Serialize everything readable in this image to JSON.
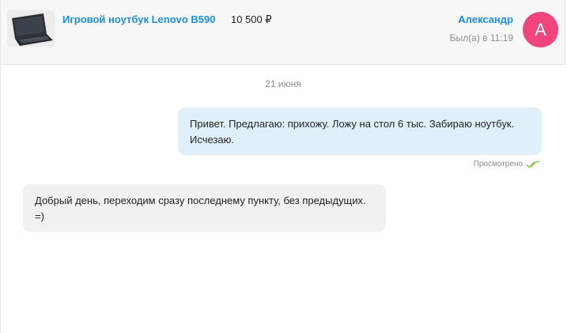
{
  "header": {
    "product": {
      "title": "Игровой ноутбук Lenovo B590",
      "price": "10 500 ₽",
      "thumbnail_icon": "laptop-photo"
    },
    "user": {
      "name": "Александр",
      "last_seen": "Был(а) в 11:19",
      "avatar_letter": "А",
      "avatar_color": "#f0457a"
    }
  },
  "chat": {
    "date_separator": "21 июня",
    "messages": [
      {
        "direction": "outgoing",
        "text": "Привет. Предлагаю: прихожу. Ложу на стол 6 тыс. Забираю ноутбук. Исчезаю.",
        "status": "Просмотрено",
        "status_icon": "double-check-icon"
      },
      {
        "direction": "incoming",
        "text": "Добрый день, переходим сразу последнему пункту, без предыдущих. =)"
      }
    ]
  },
  "colors": {
    "accent": "#1a8ee0",
    "outgoing_bubble": "#dff0fb",
    "incoming_bubble": "#f1f1f1",
    "read_check": "#8bc34a"
  }
}
